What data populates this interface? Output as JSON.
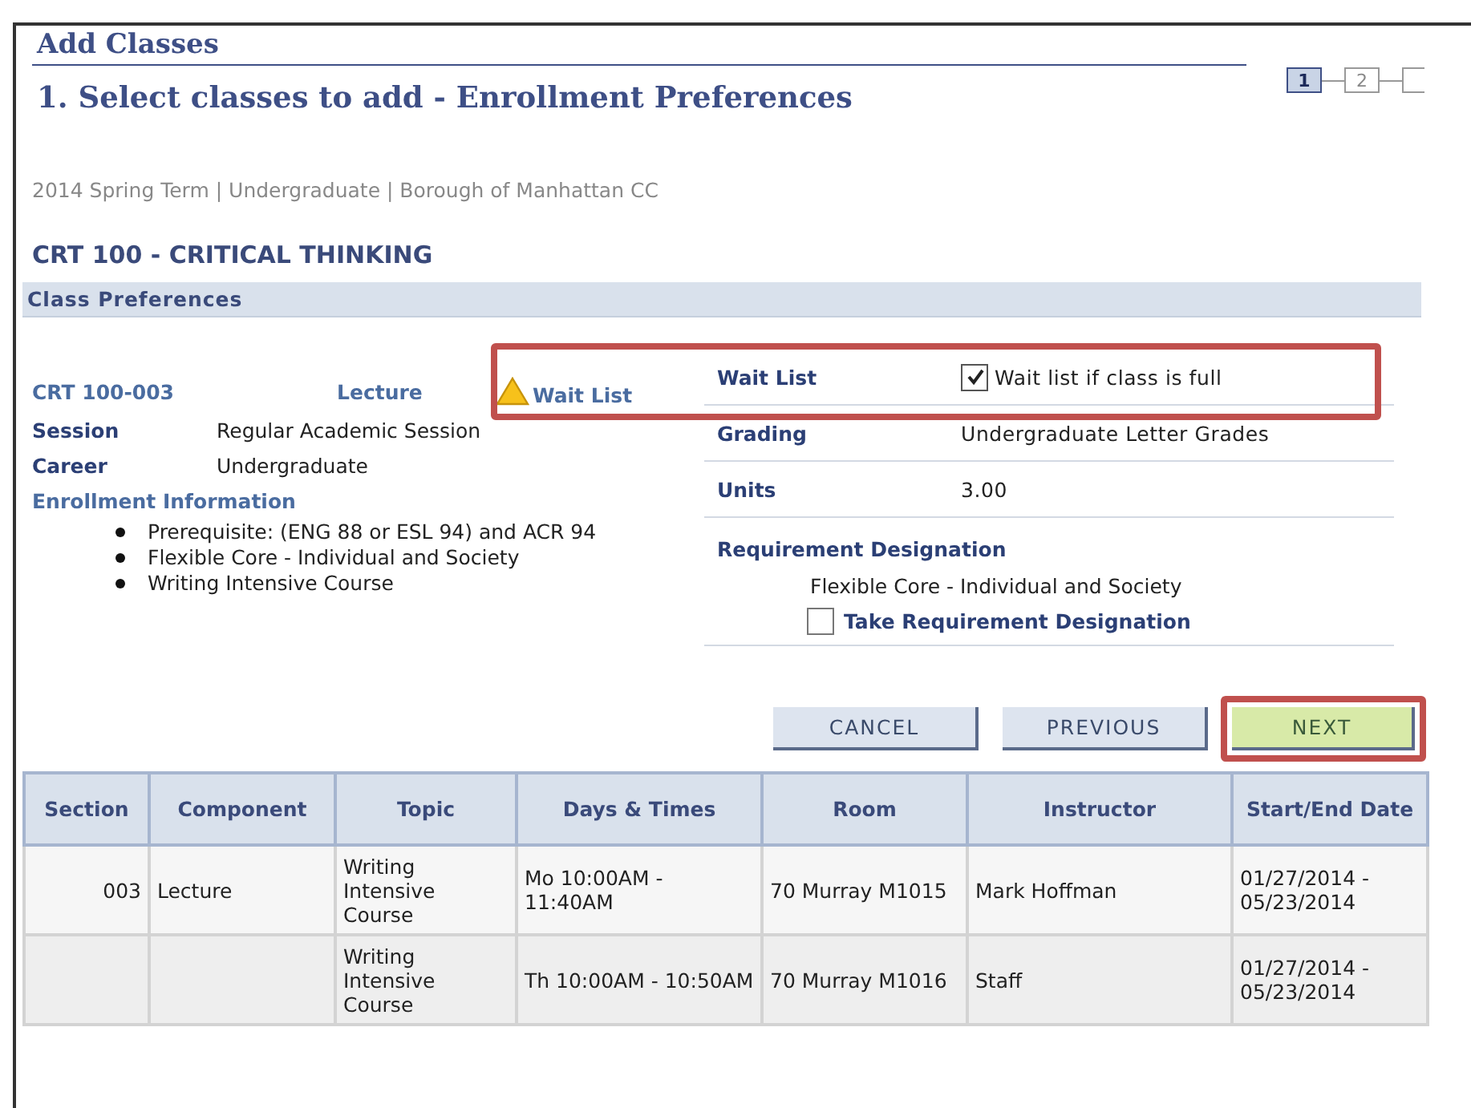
{
  "title": "Add Classes",
  "steps": [
    {
      "label": "1",
      "selected": true
    },
    {
      "label": "2",
      "selected": false
    }
  ],
  "subtitle": "1.  Select classes to add - Enrollment Preferences",
  "term_line": "2014 Spring Term | Undergraduate | Borough of Manhattan CC",
  "course_title": "CRT  100 - CRITICAL THINKING",
  "section_header": "Class Preferences",
  "class_line": {
    "section": "CRT  100-003",
    "component": "Lecture",
    "status": "Wait List",
    "highlighted": true
  },
  "details": [
    {
      "label": "Session",
      "value": "Regular Academic Session"
    },
    {
      "label": "Career",
      "value": "Undergraduate"
    }
  ],
  "enrollment_info": {
    "heading": "Enrollment Information",
    "items": [
      "Prerequisite: (ENG 88 or ESL 94) and ACR 94",
      "Flexible Core - Individual and Society",
      "Writing Intensive Course"
    ]
  },
  "preferences": [
    {
      "kind": "checkbox",
      "label": "Wait List",
      "option": "Wait list if class is full",
      "checked": true
    },
    {
      "kind": "text",
      "label": "Grading",
      "value": "Undergraduate Letter Grades"
    },
    {
      "kind": "text",
      "label": "Units",
      "value": "3.00"
    }
  ],
  "requirement": {
    "heading": "Requirement Designation",
    "value": "Flexible Core - Individual and Society",
    "option": "Take Requirement Designation",
    "checked": false
  },
  "buttons": [
    {
      "label": "CANCEL",
      "kind": "secondary",
      "highlighted": false
    },
    {
      "label": "PREVIOUS",
      "kind": "secondary",
      "highlighted": false
    },
    {
      "label": "NEXT",
      "kind": "primary",
      "highlighted": true
    }
  ],
  "table": {
    "columns": [
      "Section",
      "Component",
      "Topic",
      "Days & Times",
      "Room",
      "Instructor",
      "Start/End Date"
    ],
    "rows": [
      [
        "003",
        "Lecture",
        "Writing Intensive Course",
        "Mo 10:00AM - 11:40AM",
        "70 Murray M1015",
        "Mark Hoffman",
        "01/27/2014 - 05/23/2014"
      ],
      [
        "",
        "",
        "Writing Intensive Course",
        "Th 10:00AM - 10:50AM",
        "70 Murray M1016",
        "Staff",
        "01/27/2014 - 05/23/2014"
      ]
    ]
  }
}
